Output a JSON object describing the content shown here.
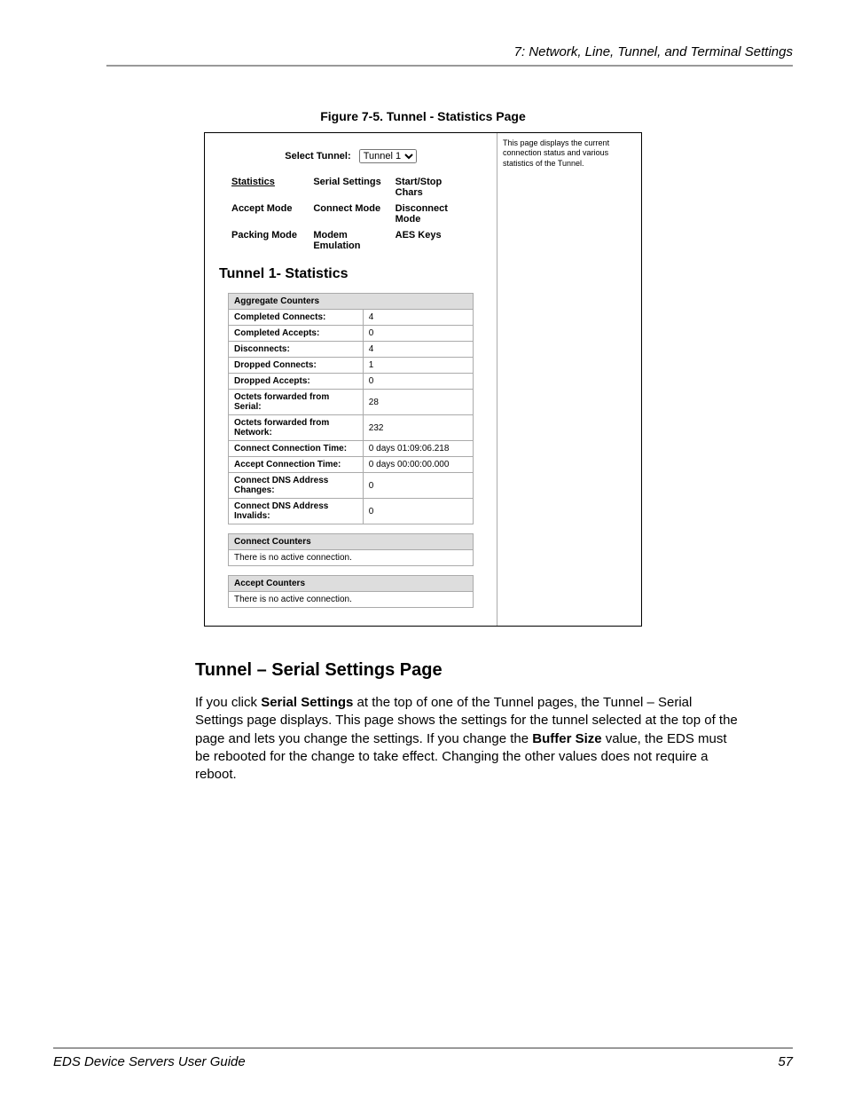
{
  "chapter_header": "7: Network, Line, Tunnel, and Terminal Settings",
  "figure_caption": "Figure 7-5. Tunnel - Statistics Page",
  "figure": {
    "select_label": "Select Tunnel:",
    "select_value": "Tunnel 1",
    "side_text": "This page displays the current connection status and various statistics of the Tunnel.",
    "tabs": {
      "row1": [
        "Statistics",
        "Serial Settings",
        "Start/Stop Chars"
      ],
      "row2": [
        "Accept Mode",
        "Connect Mode",
        "Disconnect Mode"
      ],
      "row3": [
        "Packing Mode",
        "Modem Emulation",
        "AES Keys"
      ]
    },
    "heading": "Tunnel 1- Statistics",
    "aggregate": {
      "title": "Aggregate Counters",
      "rows": [
        {
          "label": "Completed Connects:",
          "value": "4"
        },
        {
          "label": "Completed Accepts:",
          "value": "0"
        },
        {
          "label": "Disconnects:",
          "value": "4"
        },
        {
          "label": "Dropped Connects:",
          "value": "1"
        },
        {
          "label": "Dropped Accepts:",
          "value": "0"
        },
        {
          "label": "Octets forwarded from Serial:",
          "value": "28"
        },
        {
          "label": "Octets forwarded from Network:",
          "value": "232"
        },
        {
          "label": "Connect Connection Time:",
          "value": "0 days 01:09:06.218"
        },
        {
          "label": "Accept Connection Time:",
          "value": "0 days 00:00:00.000"
        },
        {
          "label": "Connect DNS Address Changes:",
          "value": "0"
        },
        {
          "label": "Connect DNS Address Invalids:",
          "value": "0"
        }
      ]
    },
    "connect_counters": {
      "title": "Connect Counters",
      "msg": "There is no active connection."
    },
    "accept_counters": {
      "title": "Accept Counters",
      "msg": "There is no active connection."
    }
  },
  "body_heading": "Tunnel – Serial Settings Page",
  "body_para_parts": {
    "p1": "If you click ",
    "b1": "Serial Settings",
    "p2": " at the top of one of the Tunnel pages, the Tunnel – Serial Settings page displays. This page shows the settings for the tunnel selected at the top of the page and lets you change the settings. If you change the ",
    "b2": "Buffer Size",
    "p3": " value, the EDS must be rebooted for the change to take effect. Changing the other values does not require a reboot."
  },
  "footer": {
    "title": "EDS Device Servers User Guide",
    "page": "57"
  }
}
